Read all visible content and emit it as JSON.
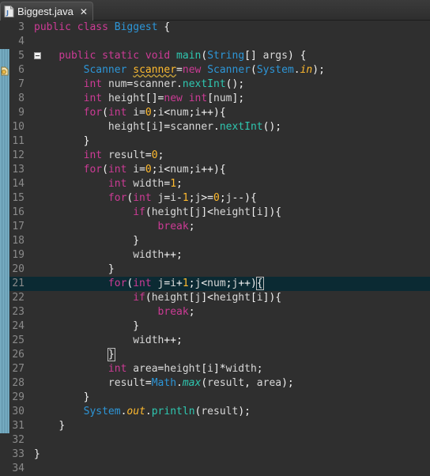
{
  "tab": {
    "title": "Biggest.java",
    "close": "✕"
  },
  "colors": {
    "keyword": "#cc3b95",
    "type": "#2d96d8",
    "field": "#ffba2e",
    "method": "#2fc7b0",
    "text": "#d9e8f7",
    "line_number": "#8a8a8a",
    "current_line_bg": "#0b2a33",
    "background": "#2f2f2f"
  },
  "editor": {
    "current_line": 21,
    "lines": [
      {
        "n": "3",
        "tokens": [
          [
            "kw",
            "public"
          ],
          [
            "",
            " "
          ],
          [
            "kw",
            "class"
          ],
          [
            "",
            " "
          ],
          [
            "ty",
            "Biggest"
          ],
          [
            "op",
            " {"
          ]
        ]
      },
      {
        "n": "4",
        "tokens": []
      },
      {
        "n": "5",
        "tokens": [
          [
            "",
            "    "
          ],
          [
            "kw",
            "public"
          ],
          [
            "",
            " "
          ],
          [
            "kw",
            "static"
          ],
          [
            "",
            " "
          ],
          [
            "kw",
            "void"
          ],
          [
            "",
            " "
          ],
          [
            "mt",
            "main"
          ],
          [
            "op",
            "("
          ],
          [
            "ty",
            "String"
          ],
          [
            "op",
            "[] "
          ],
          [
            "vr",
            "args"
          ],
          [
            "op",
            ") {"
          ]
        ]
      },
      {
        "n": "6",
        "tokens": [
          [
            "",
            "        "
          ],
          [
            "ty",
            "Scanner"
          ],
          [
            "",
            " "
          ],
          [
            "fld sq",
            "scanner"
          ],
          [
            "op",
            "="
          ],
          [
            "kw",
            "new"
          ],
          [
            "",
            " "
          ],
          [
            "ty",
            "Scanner"
          ],
          [
            "op",
            "("
          ],
          [
            "ty",
            "System"
          ],
          [
            "op",
            "."
          ],
          [
            "fld it",
            "in"
          ],
          [
            "op",
            ");"
          ]
        ]
      },
      {
        "n": "7",
        "tokens": [
          [
            "",
            "        "
          ],
          [
            "kw",
            "int"
          ],
          [
            "",
            " "
          ],
          [
            "vr",
            "num"
          ],
          [
            "op",
            "="
          ],
          [
            "vr",
            "scanner"
          ],
          [
            "op",
            "."
          ],
          [
            "mt",
            "nextInt"
          ],
          [
            "op",
            "();"
          ]
        ]
      },
      {
        "n": "8",
        "tokens": [
          [
            "",
            "        "
          ],
          [
            "kw",
            "int"
          ],
          [
            "",
            " "
          ],
          [
            "vr",
            "height"
          ],
          [
            "op",
            "[]="
          ],
          [
            "kw",
            "new"
          ],
          [
            "",
            " "
          ],
          [
            "kw",
            "int"
          ],
          [
            "op",
            "["
          ],
          [
            "vr",
            "num"
          ],
          [
            "op",
            "];"
          ]
        ]
      },
      {
        "n": "9",
        "tokens": [
          [
            "",
            "        "
          ],
          [
            "kw",
            "for"
          ],
          [
            "op",
            "("
          ],
          [
            "kw",
            "int"
          ],
          [
            "",
            " "
          ],
          [
            "vr",
            "i"
          ],
          [
            "op",
            "="
          ],
          [
            "num",
            "0"
          ],
          [
            "op",
            ";"
          ],
          [
            "vr",
            "i"
          ],
          [
            "op",
            "<"
          ],
          [
            "vr",
            "num"
          ],
          [
            "op",
            ";"
          ],
          [
            "vr",
            "i"
          ],
          [
            "op",
            "++){"
          ]
        ]
      },
      {
        "n": "10",
        "tokens": [
          [
            "",
            "            "
          ],
          [
            "vr",
            "height"
          ],
          [
            "op",
            "["
          ],
          [
            "vr",
            "i"
          ],
          [
            "op",
            "]="
          ],
          [
            "vr",
            "scanner"
          ],
          [
            "op",
            "."
          ],
          [
            "mt",
            "nextInt"
          ],
          [
            "op",
            "();"
          ]
        ]
      },
      {
        "n": "11",
        "tokens": [
          [
            "",
            "        "
          ],
          [
            "op",
            "}"
          ]
        ]
      },
      {
        "n": "12",
        "tokens": [
          [
            "",
            "        "
          ],
          [
            "kw",
            "int"
          ],
          [
            "",
            " "
          ],
          [
            "vr",
            "result"
          ],
          [
            "op",
            "="
          ],
          [
            "num",
            "0"
          ],
          [
            "op",
            ";"
          ]
        ]
      },
      {
        "n": "13",
        "tokens": [
          [
            "",
            "        "
          ],
          [
            "kw",
            "for"
          ],
          [
            "op",
            "("
          ],
          [
            "kw",
            "int"
          ],
          [
            "",
            " "
          ],
          [
            "vr",
            "i"
          ],
          [
            "op",
            "="
          ],
          [
            "num",
            "0"
          ],
          [
            "op",
            ";"
          ],
          [
            "vr",
            "i"
          ],
          [
            "op",
            "<"
          ],
          [
            "vr",
            "num"
          ],
          [
            "op",
            ";"
          ],
          [
            "vr",
            "i"
          ],
          [
            "op",
            "++){"
          ]
        ]
      },
      {
        "n": "14",
        "tokens": [
          [
            "",
            "            "
          ],
          [
            "kw",
            "int"
          ],
          [
            "",
            " "
          ],
          [
            "vr",
            "width"
          ],
          [
            "op",
            "="
          ],
          [
            "num",
            "1"
          ],
          [
            "op",
            ";"
          ]
        ]
      },
      {
        "n": "15",
        "tokens": [
          [
            "",
            "            "
          ],
          [
            "kw",
            "for"
          ],
          [
            "op",
            "("
          ],
          [
            "kw",
            "int"
          ],
          [
            "",
            " "
          ],
          [
            "vr",
            "j"
          ],
          [
            "op",
            "="
          ],
          [
            "vr",
            "i"
          ],
          [
            "op",
            "-"
          ],
          [
            "num",
            "1"
          ],
          [
            "op",
            ";"
          ],
          [
            "vr",
            "j"
          ],
          [
            "op",
            ">="
          ],
          [
            "num",
            "0"
          ],
          [
            "op",
            ";"
          ],
          [
            "vr",
            "j"
          ],
          [
            "op",
            "--){"
          ]
        ]
      },
      {
        "n": "16",
        "tokens": [
          [
            "",
            "                "
          ],
          [
            "kw",
            "if"
          ],
          [
            "op",
            "("
          ],
          [
            "vr",
            "height"
          ],
          [
            "op",
            "["
          ],
          [
            "vr",
            "j"
          ],
          [
            "op",
            "]<"
          ],
          [
            "vr",
            "height"
          ],
          [
            "op",
            "["
          ],
          [
            "vr",
            "i"
          ],
          [
            "op",
            "]){"
          ]
        ]
      },
      {
        "n": "17",
        "tokens": [
          [
            "",
            "                    "
          ],
          [
            "kw",
            "break"
          ],
          [
            "op",
            ";"
          ]
        ]
      },
      {
        "n": "18",
        "tokens": [
          [
            "",
            "                "
          ],
          [
            "op",
            "}"
          ]
        ]
      },
      {
        "n": "19",
        "tokens": [
          [
            "",
            "                "
          ],
          [
            "vr",
            "width"
          ],
          [
            "op",
            "++;"
          ]
        ]
      },
      {
        "n": "20",
        "tokens": [
          [
            "",
            "            "
          ],
          [
            "op",
            "}"
          ]
        ]
      },
      {
        "n": "21",
        "tokens": [
          [
            "",
            "            "
          ],
          [
            "kw",
            "for"
          ],
          [
            "op",
            "("
          ],
          [
            "kw",
            "int"
          ],
          [
            "",
            " "
          ],
          [
            "vr",
            "j"
          ],
          [
            "op",
            "="
          ],
          [
            "vr",
            "i"
          ],
          [
            "op",
            "+"
          ],
          [
            "num",
            "1"
          ],
          [
            "op",
            ";"
          ],
          [
            "vr",
            "j"
          ],
          [
            "op",
            "<"
          ],
          [
            "vr",
            "num"
          ],
          [
            "op",
            ";"
          ],
          [
            "vr",
            "j"
          ],
          [
            "op",
            "++)"
          ],
          [
            "op bm",
            "{"
          ]
        ]
      },
      {
        "n": "22",
        "tokens": [
          [
            "",
            "                "
          ],
          [
            "kw",
            "if"
          ],
          [
            "op",
            "("
          ],
          [
            "vr",
            "height"
          ],
          [
            "op",
            "["
          ],
          [
            "vr",
            "j"
          ],
          [
            "op",
            "]<"
          ],
          [
            "vr",
            "height"
          ],
          [
            "op",
            "["
          ],
          [
            "vr",
            "i"
          ],
          [
            "op",
            "]){"
          ]
        ]
      },
      {
        "n": "23",
        "tokens": [
          [
            "",
            "                    "
          ],
          [
            "kw",
            "break"
          ],
          [
            "op",
            ";"
          ]
        ]
      },
      {
        "n": "24",
        "tokens": [
          [
            "",
            "                "
          ],
          [
            "op",
            "}"
          ]
        ]
      },
      {
        "n": "25",
        "tokens": [
          [
            "",
            "                "
          ],
          [
            "vr",
            "width"
          ],
          [
            "op",
            "++;"
          ]
        ]
      },
      {
        "n": "26",
        "tokens": [
          [
            "",
            "            "
          ],
          [
            "op bm",
            "}"
          ]
        ]
      },
      {
        "n": "27",
        "tokens": [
          [
            "",
            "            "
          ],
          [
            "kw",
            "int"
          ],
          [
            "",
            " "
          ],
          [
            "vr",
            "area"
          ],
          [
            "op",
            "="
          ],
          [
            "vr",
            "height"
          ],
          [
            "op",
            "["
          ],
          [
            "vr",
            "i"
          ],
          [
            "op",
            "]*"
          ],
          [
            "vr",
            "width"
          ],
          [
            "op",
            ";"
          ]
        ]
      },
      {
        "n": "28",
        "tokens": [
          [
            "",
            "            "
          ],
          [
            "vr",
            "result"
          ],
          [
            "op",
            "="
          ],
          [
            "ty",
            "Math"
          ],
          [
            "op",
            "."
          ],
          [
            "mt it",
            "max"
          ],
          [
            "op",
            "("
          ],
          [
            "vr",
            "result"
          ],
          [
            "op",
            ", "
          ],
          [
            "vr",
            "area"
          ],
          [
            "op",
            ");"
          ]
        ]
      },
      {
        "n": "29",
        "tokens": [
          [
            "",
            "        "
          ],
          [
            "op",
            "}"
          ]
        ]
      },
      {
        "n": "30",
        "tokens": [
          [
            "",
            "        "
          ],
          [
            "ty",
            "System"
          ],
          [
            "op",
            "."
          ],
          [
            "fld it",
            "out"
          ],
          [
            "op",
            "."
          ],
          [
            "mt",
            "println"
          ],
          [
            "op",
            "("
          ],
          [
            "vr",
            "result"
          ],
          [
            "op",
            ");"
          ]
        ]
      },
      {
        "n": "31",
        "tokens": [
          [
            "",
            "    "
          ],
          [
            "op",
            "}"
          ]
        ]
      },
      {
        "n": "32",
        "tokens": []
      },
      {
        "n": "33",
        "tokens": [
          [
            "op",
            "}"
          ]
        ]
      },
      {
        "n": "34",
        "tokens": []
      }
    ]
  }
}
